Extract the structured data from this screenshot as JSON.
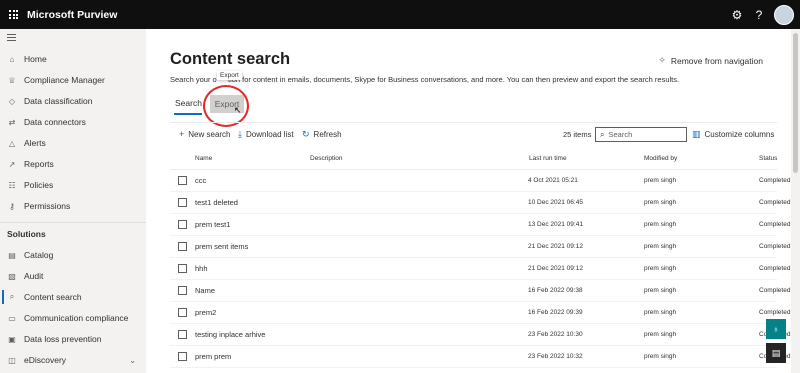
{
  "app": {
    "title": "Microsoft Purview",
    "icons": [
      "app-launcher-icon",
      "settings-icon",
      "help-icon",
      "avatar"
    ]
  },
  "sidebar": {
    "items": [
      {
        "label": "Home",
        "icon": "home-icon",
        "glyph": "⌂"
      },
      {
        "label": "Compliance Manager",
        "icon": "trophy-icon",
        "glyph": "♕"
      },
      {
        "label": "Data classification",
        "icon": "tag-icon",
        "glyph": "◇"
      },
      {
        "label": "Data connectors",
        "icon": "connector-icon",
        "glyph": "⇄"
      },
      {
        "label": "Alerts",
        "icon": "alert-icon",
        "glyph": "△"
      },
      {
        "label": "Reports",
        "icon": "reports-icon",
        "glyph": "↗"
      },
      {
        "label": "Policies",
        "icon": "policies-icon",
        "glyph": "☷"
      },
      {
        "label": "Permissions",
        "icon": "key-icon",
        "glyph": "⚷"
      }
    ],
    "section_title": "Solutions",
    "solutions": [
      {
        "label": "Catalog",
        "icon": "catalog-icon",
        "glyph": "▤"
      },
      {
        "label": "Audit",
        "icon": "audit-icon",
        "glyph": "▧"
      },
      {
        "label": "Content search",
        "icon": "search-icon",
        "glyph": "⌕",
        "active": true
      },
      {
        "label": "Communication compliance",
        "icon": "chat-icon",
        "glyph": "▭"
      },
      {
        "label": "Data loss prevention",
        "icon": "shield-icon",
        "glyph": "▣"
      },
      {
        "label": "eDiscovery",
        "icon": "briefcase-icon",
        "glyph": "◫"
      }
    ]
  },
  "main": {
    "title": "Content search",
    "remove_nav_label": "Remove from navigation",
    "description_start": "Search your o",
    "description_rest": "tion for content in emails, documents, Skype for Business conversations, and more. You can then preview and export the search results.",
    "tooltip": "Export",
    "tabs": [
      {
        "label": "Search"
      },
      {
        "label": "Export"
      }
    ],
    "toolbar": {
      "new_search": "New search",
      "download_list": "Download list",
      "refresh": "Refresh",
      "items_count": "25 items",
      "search_placeholder": "Search",
      "customize_columns": "Customize columns"
    },
    "columns": [
      "Name",
      "Description",
      "Last run time",
      "Modified by",
      "Status"
    ],
    "rows": [
      {
        "name": "ccc",
        "last_run": "4 Oct 2021 05:21",
        "modified_by": "prem singh",
        "status": "Completed"
      },
      {
        "name": "test1 deleted",
        "last_run": "10 Dec 2021 06:45",
        "modified_by": "prem singh",
        "status": "Completed"
      },
      {
        "name": "prem test1",
        "last_run": "13 Dec 2021 09:41",
        "modified_by": "prem singh",
        "status": "Completed"
      },
      {
        "name": "prem sent items",
        "last_run": "21 Dec 2021 09:12",
        "modified_by": "prem singh",
        "status": "Completed"
      },
      {
        "name": "hhh",
        "last_run": "21 Dec 2021 09:12",
        "modified_by": "prem singh",
        "status": "Completed"
      },
      {
        "name": "Name",
        "last_run": "16 Feb 2022 09:38",
        "modified_by": "prem singh",
        "status": "Completed"
      },
      {
        "name": "prem2",
        "last_run": "16 Feb 2022 09:39",
        "modified_by": "prem singh",
        "status": "Completed"
      },
      {
        "name": "testing inplace arhive",
        "last_run": "23 Feb 2022 10:30",
        "modified_by": "prem singh",
        "status": "Completed"
      },
      {
        "name": "prem prem",
        "last_run": "23 Feb 2022 10:32",
        "modified_by": "prem singh",
        "status": "Completed"
      }
    ]
  },
  "colors": {
    "accent": "#0f6cbd",
    "highlight_circle": "#e02b2b",
    "topbar": "#0f0f0f",
    "help_button": "#038387"
  }
}
